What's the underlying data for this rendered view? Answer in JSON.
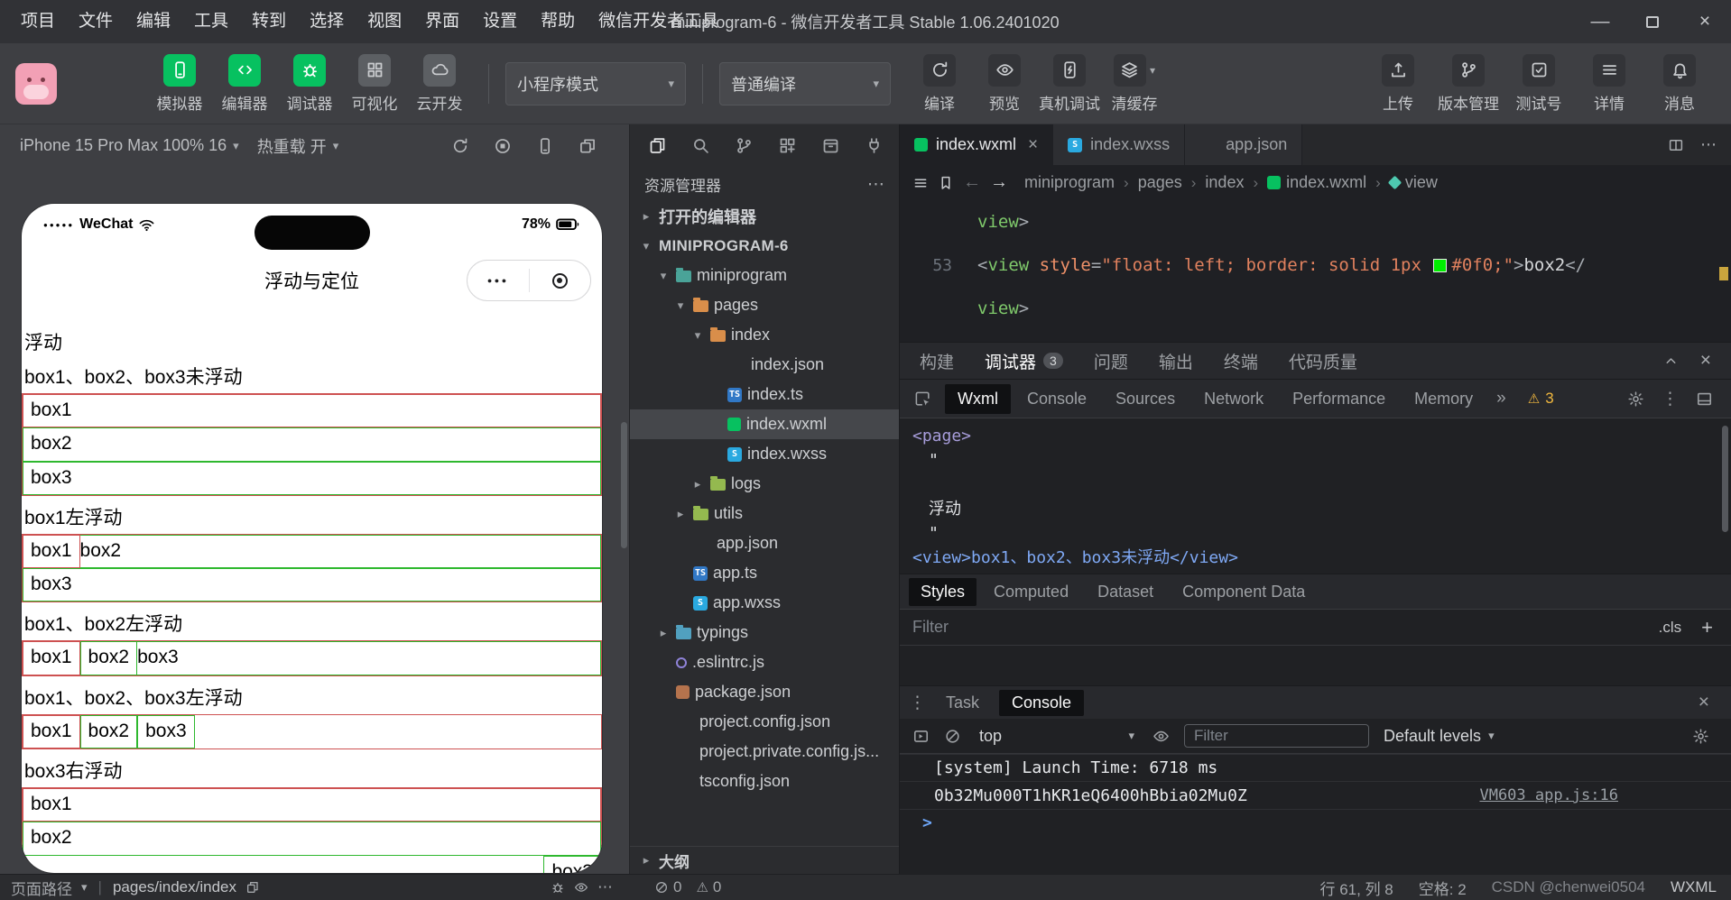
{
  "titlebar": {
    "menus": [
      "项目",
      "文件",
      "编辑",
      "工具",
      "转到",
      "选择",
      "视图",
      "界面",
      "设置",
      "帮助",
      "微信开发者工具"
    ],
    "title": "miniprogram-6 - 微信开发者工具 Stable 1.06.2401020"
  },
  "toolbar": {
    "main_buttons": [
      {
        "label": "模拟器",
        "icon": "simulator",
        "active": true
      },
      {
        "label": "编辑器",
        "icon": "editor",
        "active": true
      },
      {
        "label": "调试器",
        "icon": "debugger",
        "active": true
      },
      {
        "label": "可视化",
        "icon": "visual",
        "active": false
      },
      {
        "label": "云开发",
        "icon": "cloud",
        "active": false
      }
    ],
    "mode_dropdown": "小程序模式",
    "compile_dropdown": "普通编译",
    "action_buttons": [
      {
        "label": "编译",
        "icon": "compile"
      },
      {
        "label": "预览",
        "icon": "preview"
      },
      {
        "label": "真机调试",
        "icon": "device-debug"
      },
      {
        "label": "清缓存",
        "icon": "clear-cache",
        "dropdown": true
      }
    ],
    "right_buttons": [
      {
        "label": "上传",
        "icon": "upload"
      },
      {
        "label": "版本管理",
        "icon": "version"
      },
      {
        "label": "测试号",
        "icon": "test"
      },
      {
        "label": "详情",
        "icon": "details"
      },
      {
        "label": "消息",
        "icon": "message"
      }
    ]
  },
  "simulator": {
    "device_label": "iPhone 15 Pro Max 100% 16",
    "hot_reload_label": "热重载 开",
    "phone": {
      "signal_dots": "●●●●●",
      "carrier": "WeChat",
      "battery": "78%",
      "nav_title": "浮动与定位",
      "heading": "浮动",
      "box_labels": [
        "box1",
        "box2",
        "box3"
      ],
      "sections": [
        {
          "label": "box1、box2、box3未浮动",
          "layout": "none"
        },
        {
          "label": "box1左浮动",
          "layout": "float1"
        },
        {
          "label": "box1、box2左浮动",
          "layout": "float12"
        },
        {
          "label": "box1、box2、box3左浮动",
          "layout": "float123"
        },
        {
          "label": "box3右浮动",
          "layout": "float3r"
        }
      ]
    },
    "footer": {
      "path_label": "页面路径",
      "path_value": "pages/index/index"
    }
  },
  "explorer": {
    "title": "资源管理器",
    "open_editors_label": "打开的编辑器",
    "root_label": "MINIPROGRAM-6",
    "tree": [
      {
        "name": "miniprogram",
        "depth": 1,
        "icon": "folder-teal",
        "chevron": "down"
      },
      {
        "name": "pages",
        "depth": 2,
        "icon": "folder-orange",
        "chevron": "down"
      },
      {
        "name": "index",
        "depth": 3,
        "icon": "folder-orange",
        "chevron": "down"
      },
      {
        "name": "index.json",
        "depth": 4,
        "icon": "json"
      },
      {
        "name": "index.ts",
        "depth": 4,
        "icon": "ts"
      },
      {
        "name": "index.wxml",
        "depth": 4,
        "icon": "wxml",
        "selected": true
      },
      {
        "name": "index.wxss",
        "depth": 4,
        "icon": "wxss"
      },
      {
        "name": "logs",
        "depth": 3,
        "icon": "folder-green",
        "chevron": "right"
      },
      {
        "name": "utils",
        "depth": 2,
        "icon": "folder-green",
        "chevron": "right"
      },
      {
        "name": "app.json",
        "depth": 2,
        "icon": "json"
      },
      {
        "name": "app.ts",
        "depth": 2,
        "icon": "ts"
      },
      {
        "name": "app.wxss",
        "depth": 2,
        "icon": "wxss"
      },
      {
        "name": "typings",
        "depth": 1,
        "icon": "folder-blue",
        "chevron": "right"
      },
      {
        "name": ".eslintrc.js",
        "depth": 1,
        "icon": "eslint"
      },
      {
        "name": "package.json",
        "depth": 1,
        "icon": "pkg"
      },
      {
        "name": "project.config.json",
        "depth": 1,
        "icon": "json"
      },
      {
        "name": "project.private.config.js...",
        "depth": 1,
        "icon": "json"
      },
      {
        "name": "tsconfig.json",
        "depth": 1,
        "icon": "json"
      }
    ],
    "outline_label": "大纲"
  },
  "editor": {
    "tabs": [
      {
        "label": "index.wxml",
        "icon": "wxml",
        "active": true,
        "closable": true
      },
      {
        "label": "index.wxss",
        "icon": "wxss",
        "active": false,
        "closable": false
      },
      {
        "label": "app.json",
        "icon": "json",
        "active": false,
        "closable": false
      }
    ],
    "breadcrumbs": [
      {
        "label": "miniprogram"
      },
      {
        "label": "pages"
      },
      {
        "label": "index"
      },
      {
        "label": "index.wxml",
        "icon": "wxml"
      },
      {
        "label": "view",
        "icon": "symbol"
      }
    ],
    "code_lines": [
      {
        "num": "",
        "segs": [
          {
            "t": "view",
            "c": "tag"
          },
          {
            "t": ">",
            "c": "punc"
          }
        ]
      },
      {
        "num": "53",
        "segs": [
          {
            "t": "<",
            "c": "punc"
          },
          {
            "t": "view",
            "c": "tag"
          },
          {
            "t": " ",
            "c": "pln"
          },
          {
            "t": "style",
            "c": "attr"
          },
          {
            "t": "=",
            "c": "punc"
          },
          {
            "t": "\"float: left; border: solid 1px ",
            "c": "str"
          },
          {
            "t": "",
            "c": "swatch",
            "color": "#00ee00"
          },
          {
            "t": "#0f0;\"",
            "c": "str"
          },
          {
            "t": ">",
            "c": "punc"
          },
          {
            "t": "box2",
            "c": "pln"
          },
          {
            "t": "</",
            "c": "punc"
          }
        ]
      },
      {
        "num": "",
        "segs": [
          {
            "t": "view",
            "c": "tag"
          },
          {
            "t": ">",
            "c": "punc"
          }
        ]
      }
    ]
  },
  "debugger": {
    "panel_tabs": [
      {
        "label": "构建",
        "active": false
      },
      {
        "label": "调试器",
        "badge": "3",
        "active": true
      },
      {
        "label": "问题",
        "active": false
      },
      {
        "label": "输出",
        "active": false
      },
      {
        "label": "终端",
        "active": false
      },
      {
        "label": "代码质量",
        "active": false
      }
    ],
    "devtools_tabs": [
      {
        "label": "Wxml",
        "active": true
      },
      {
        "label": "Console",
        "active": false
      },
      {
        "label": "Sources",
        "active": false
      },
      {
        "label": "Network",
        "active": false
      },
      {
        "label": "Performance",
        "active": false
      },
      {
        "label": "Memory",
        "active": false
      }
    ],
    "overflow_indicator": "»",
    "warning_count": "3",
    "wxml_lines": [
      {
        "text": "<page>",
        "c": "node"
      },
      {
        "text": "\"",
        "c": "txt"
      },
      {
        "text": "",
        "c": "txt"
      },
      {
        "text": "浮动",
        "c": "txt"
      },
      {
        "text": "\"",
        "c": "txt"
      },
      {
        "text": "<view>box1、box2、box3未浮动</view>",
        "c": "link"
      }
    ],
    "styles_tabs": [
      {
        "label": "Styles",
        "active": true
      },
      {
        "label": "Computed",
        "active": false
      },
      {
        "label": "Dataset",
        "active": false
      },
      {
        "label": "Component Data",
        "active": false
      }
    ],
    "filter_placeholder": "Filter",
    "cls_label": ".cls"
  },
  "console": {
    "task_tab": "Task",
    "console_tab": "Console",
    "context": "top",
    "filter_placeholder": "Filter",
    "levels_label": "Default levels",
    "logs": [
      {
        "text": "[system] Launch Time: 6718 ms",
        "source": ""
      },
      {
        "text": "0b32Mu000T1hKR1eQ6400hBbia02Mu0Z",
        "source": "VM603 app.js:16"
      }
    ],
    "prompt": ">"
  },
  "statusbar": {
    "errors": "0",
    "warnings": "0",
    "cursor": "行 61, 列 8",
    "spaces": "空格: 2",
    "watermark": "CSDN @chenwei0504",
    "lang": "WXML"
  },
  "colors": {
    "wechat_green": "#07c160",
    "box_red": "#cd5151",
    "box_green": "#2eb82e",
    "code_swatch": "#00ee00"
  }
}
